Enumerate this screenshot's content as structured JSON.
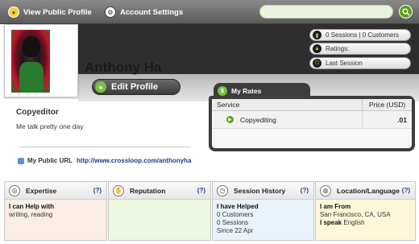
{
  "topbar": {
    "view_public_profile": "View Public Profile",
    "account_settings": "Account Settings",
    "search_placeholder": ""
  },
  "profile": {
    "name": "Anthony Ha",
    "edit_profile": "Edit Profile",
    "title": "Copyeditor",
    "tagline": "Me talk pretty one day",
    "public_url_label": "My Public URL",
    "public_url": "http://www.crossloop.com/anthonyha"
  },
  "stats": {
    "sessions": "0 Sessions | 0 Customers",
    "ratings": "Ratings:",
    "last_session": "Last Session"
  },
  "rates": {
    "tab_label": "My Rates",
    "col_service": "Service",
    "col_price": "Price (USD)",
    "rows": [
      {
        "service": "Copyediting",
        "price": ".01"
      }
    ]
  },
  "panels": {
    "expertise": {
      "title": "Expertise",
      "help": "(?)",
      "heading": "I can Help with",
      "text": "writing, reading"
    },
    "reputation": {
      "title": "Reputation",
      "help": "(?)"
    },
    "session_history": {
      "title": "Session History",
      "help": "(?)",
      "heading": "I have Helped",
      "customers": "0 Customers",
      "sessions": "0 Sessions",
      "since": "Since 22 Apr"
    },
    "location": {
      "title": "Location/Language",
      "help": "(?)",
      "from_label": "I am From",
      "from": "San Francisco, CA, USA",
      "speak_label": "I speak",
      "speak": "English"
    }
  },
  "colors": {
    "accent_green": "#7ac143",
    "header_dark": "#2e2e2e",
    "link_blue": "#1a3e8a"
  }
}
